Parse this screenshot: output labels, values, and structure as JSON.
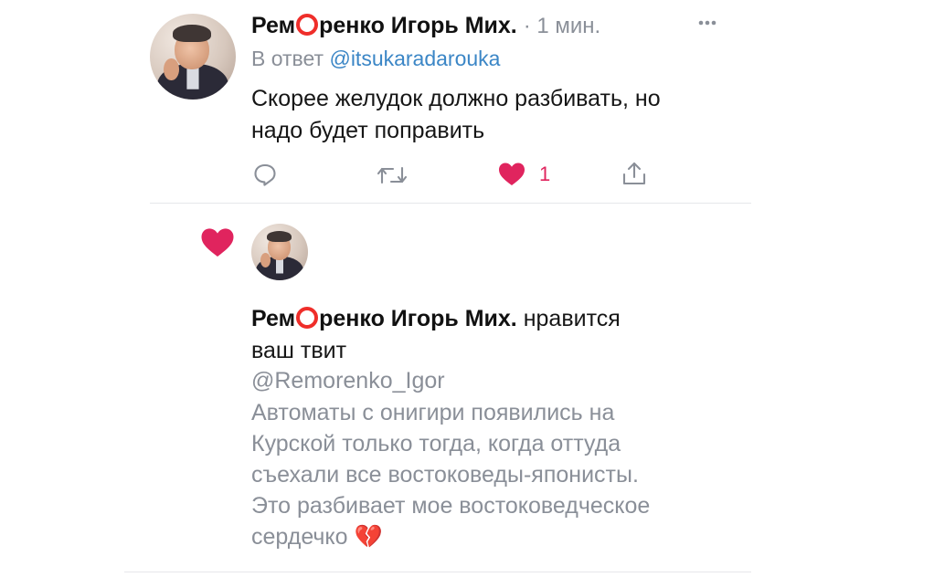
{
  "reply_tweet": {
    "author_name_part1": "Рем",
    "author_name_part2": "ренко Игорь Мих.",
    "time_ago": "· 1 мин.",
    "more_icon": "more-dots-icon",
    "reply_prefix": "В ответ",
    "reply_handle": "@itsukaradarouka",
    "text_line1": "Скорее желудок должно разбивать, но",
    "text_line2": "надо будет поправить",
    "actions": {
      "reply_icon": "reply-bubble-icon",
      "retweet_icon": "retweet-icon",
      "like_icon": "heart-icon",
      "like_count": "1",
      "share_icon": "share-icon"
    }
  },
  "like_notification": {
    "icon": "heart-icon",
    "author_name_part1": "Рем",
    "author_name_part2": "ренко Игорь Мих.",
    "liked_text_line1": "нравится",
    "liked_text_line2": "ваш твит",
    "handle": "@Remorenko_Igor",
    "quoted_lines": [
      "Автоматы с онигири появились на",
      "Курской только тогда, когда оттуда",
      "съехали все востоковеды-японисты.",
      "Это разбивает мое востоковедческое",
      "сердечко"
    ],
    "emoji": "💔"
  },
  "colors": {
    "accent_red": "#ef2e2a",
    "heart_pink": "#e0245e",
    "link_blue": "#3b86c6",
    "muted_gray": "#8a8f98",
    "divider": "#e6e7ea"
  }
}
